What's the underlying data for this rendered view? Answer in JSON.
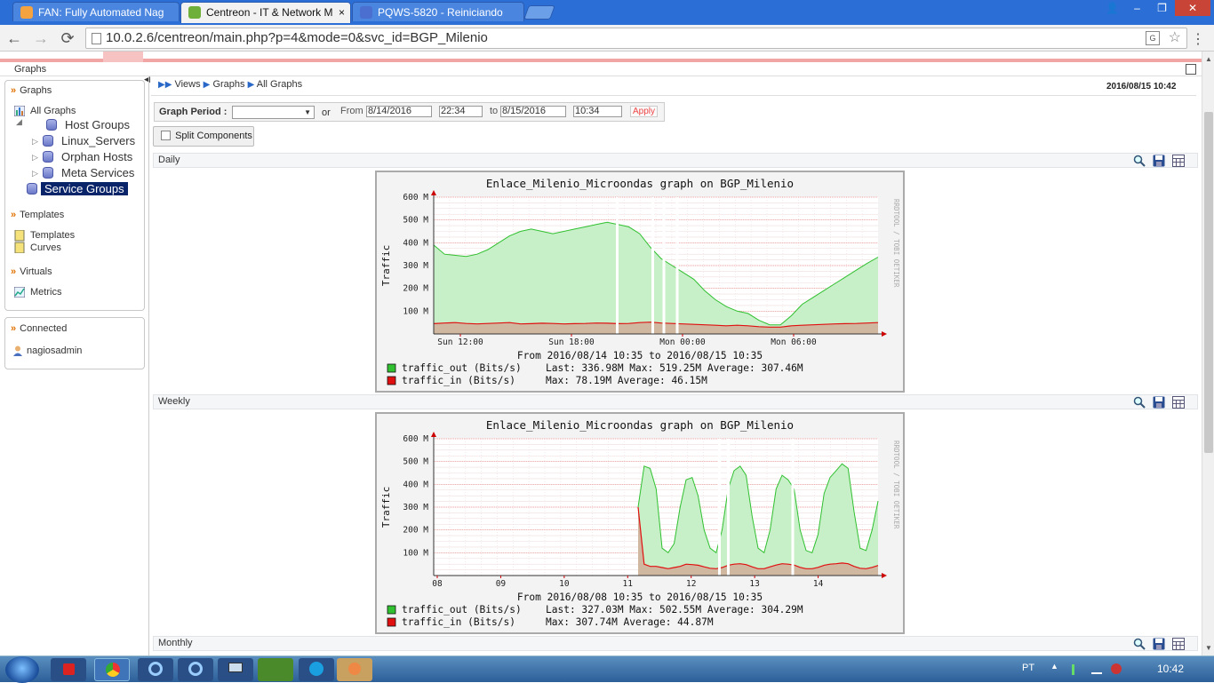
{
  "browser": {
    "tabs": [
      {
        "title": "FAN: Fully Automated Nag",
        "color": "#f4a340"
      },
      {
        "title": "Centreon - IT & Network M",
        "color": "#6fb03a"
      },
      {
        "title": "PQWS-5820 - Reiniciando",
        "color": "#4a6fd0"
      }
    ],
    "tab_close": "×",
    "url": "10.0.2.6/centreon/main.php?p=4&mode=0&svc_id=BGP_Milenio",
    "translate_icon": "G",
    "nav": {
      "back": "←",
      "forward": "→",
      "reload": "⟳",
      "star": "☆",
      "menu": "⋮"
    },
    "window_controls": {
      "user": "👤",
      "minimize": "–",
      "maximize": "❐",
      "close": "✕"
    }
  },
  "page": {
    "section_label": "Graphs",
    "breadcrumb": [
      "Views",
      "Graphs",
      "All Graphs"
    ],
    "datetime": "2016/08/15 10:42"
  },
  "sidebar": {
    "graphs_title": "Graphs",
    "all_graphs": "All Graphs",
    "tree": [
      "Host Groups",
      "Linux_Servers",
      "Orphan Hosts",
      "Meta Services",
      "Service Groups"
    ],
    "templates_title": "Templates",
    "templates_items": [
      "Templates",
      "Curves"
    ],
    "virtuals_title": "Virtuals",
    "metrics": "Metrics",
    "connected_title": "Connected",
    "user": "nagiosadmin"
  },
  "period": {
    "label": "Graph Period :",
    "or": "or",
    "from_label": "From",
    "from_date": "8/14/2016",
    "from_time": "22:34",
    "to_label": "to",
    "to_date": "8/15/2016",
    "to_time": "10:34",
    "apply": "Apply"
  },
  "split_components": "Split Components",
  "colors": {
    "out_fill": "#c8f0c8",
    "out_line": "#30c030",
    "in_fill": "#d0b8a0",
    "in_line": "#e01010"
  },
  "chart_data": [
    {
      "type": "area",
      "band_label": "Daily",
      "title": "Enlace_Milenio_Microondas graph on BGP_Milenio",
      "ylabel": "Traffic",
      "yticks": [
        "100 M",
        "200 M",
        "300 M",
        "400 M",
        "500 M",
        "600 M"
      ],
      "ylim": [
        0,
        600
      ],
      "xticks": [
        "Sun 12:00",
        "Sun 18:00",
        "Mon 00:00",
        "Mon 06:00"
      ],
      "range_text": "From 2016/08/14 10:35 to 2016/08/15 10:35",
      "watermark": "RRDTOOL / TOBI OETIKER",
      "legend": [
        {
          "name": "traffic_out (Bits/s)",
          "stats": "Last: 336.98M  Max: 519.25M  Average: 307.46M"
        },
        {
          "name": "traffic_in (Bits/s)",
          "stats": "Max:  78.19M  Average:  46.15M"
        }
      ],
      "series": [
        {
          "name": "traffic_out (Bits/s)",
          "values": [
            390,
            350,
            345,
            340,
            350,
            370,
            400,
            430,
            450,
            460,
            450,
            440,
            450,
            460,
            470,
            480,
            490,
            480,
            470,
            440,
            380,
            330,
            300,
            270,
            240,
            190,
            150,
            120,
            100,
            90,
            60,
            40,
            40,
            80,
            130,
            160,
            190,
            220,
            250,
            280,
            310,
            336.98
          ]
        },
        {
          "name": "traffic_in (Bits/s)",
          "values": [
            45,
            48,
            50,
            46,
            44,
            46,
            48,
            50,
            44,
            45,
            47,
            46,
            44,
            45,
            46,
            48,
            47,
            45,
            46,
            50,
            52,
            48,
            46,
            44,
            42,
            40,
            38,
            36,
            38,
            36,
            32,
            30,
            30,
            36,
            38,
            40,
            42,
            44,
            45,
            46,
            48,
            50
          ]
        }
      ],
      "gaps": [
        0.41,
        0.49,
        0.515,
        0.545
      ]
    },
    {
      "type": "area",
      "band_label": "Weekly",
      "title": "Enlace_Milenio_Microondas graph on BGP_Milenio",
      "ylabel": "Traffic",
      "yticks": [
        "100 M",
        "200 M",
        "300 M",
        "400 M",
        "500 M",
        "600 M"
      ],
      "ylim": [
        0,
        600
      ],
      "xticks": [
        "08",
        "09",
        "10",
        "11",
        "12",
        "13",
        "14"
      ],
      "range_text": "From 2016/08/08 10:35 to 2016/08/15 10:35",
      "watermark": "RRDTOOL / TOBI OETIKER",
      "legend": [
        {
          "name": "traffic_out (Bits/s)",
          "stats": "Last: 327.03M  Max: 502.55M  Average: 304.29M"
        },
        {
          "name": "traffic_in (Bits/s)",
          "stats": "Max: 307.74M  Average:  44.87M"
        }
      ],
      "data_start": 0.46,
      "series": [
        {
          "name": "traffic_out (Bits/s)",
          "values": [
            300,
            480,
            470,
            380,
            120,
            100,
            140,
            300,
            420,
            430,
            350,
            200,
            120,
            100,
            200,
            380,
            460,
            480,
            440,
            260,
            120,
            100,
            200,
            380,
            440,
            420,
            380,
            200,
            110,
            100,
            180,
            360,
            430,
            460,
            490,
            470,
            280,
            120,
            110,
            200,
            327.03
          ]
        },
        {
          "name": "traffic_in (Bits/s)",
          "values": [
            300,
            50,
            40,
            40,
            35,
            30,
            35,
            40,
            50,
            48,
            45,
            38,
            32,
            30,
            35,
            45,
            50,
            52,
            48,
            38,
            30,
            30,
            38,
            46,
            52,
            50,
            46,
            36,
            30,
            30,
            36,
            45,
            50,
            52,
            55,
            52,
            40,
            32,
            30,
            36,
            44
          ]
        }
      ],
      "gaps": [
        0.64,
        0.66,
        0.805
      ]
    }
  ],
  "monthly_label": "Monthly",
  "taskbar": {
    "lang": "PT",
    "time": "10:42"
  }
}
